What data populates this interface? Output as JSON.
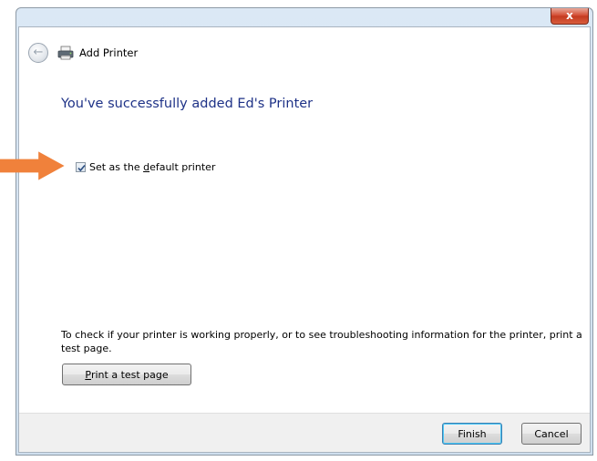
{
  "window": {
    "close_glyph": "x"
  },
  "header": {
    "title": "Add Printer",
    "back_icon": "back-arrow-icon",
    "printer_icon": "printer-icon"
  },
  "main": {
    "heading": "You've successfully added Ed's Printer",
    "default_checkbox": {
      "checked": true,
      "label_before": "Set as the ",
      "label_underlined": "d",
      "label_after": "efault printer"
    },
    "info_text": "To check if your printer is working properly, or to see troubleshooting information for the printer, print a test page.",
    "test_button": {
      "underlined": "P",
      "rest": "rint a test page"
    }
  },
  "footer": {
    "finish_label": "Finish",
    "cancel_label": "Cancel"
  },
  "colors": {
    "heading": "#1e3287",
    "arrow": "#f0813b"
  }
}
